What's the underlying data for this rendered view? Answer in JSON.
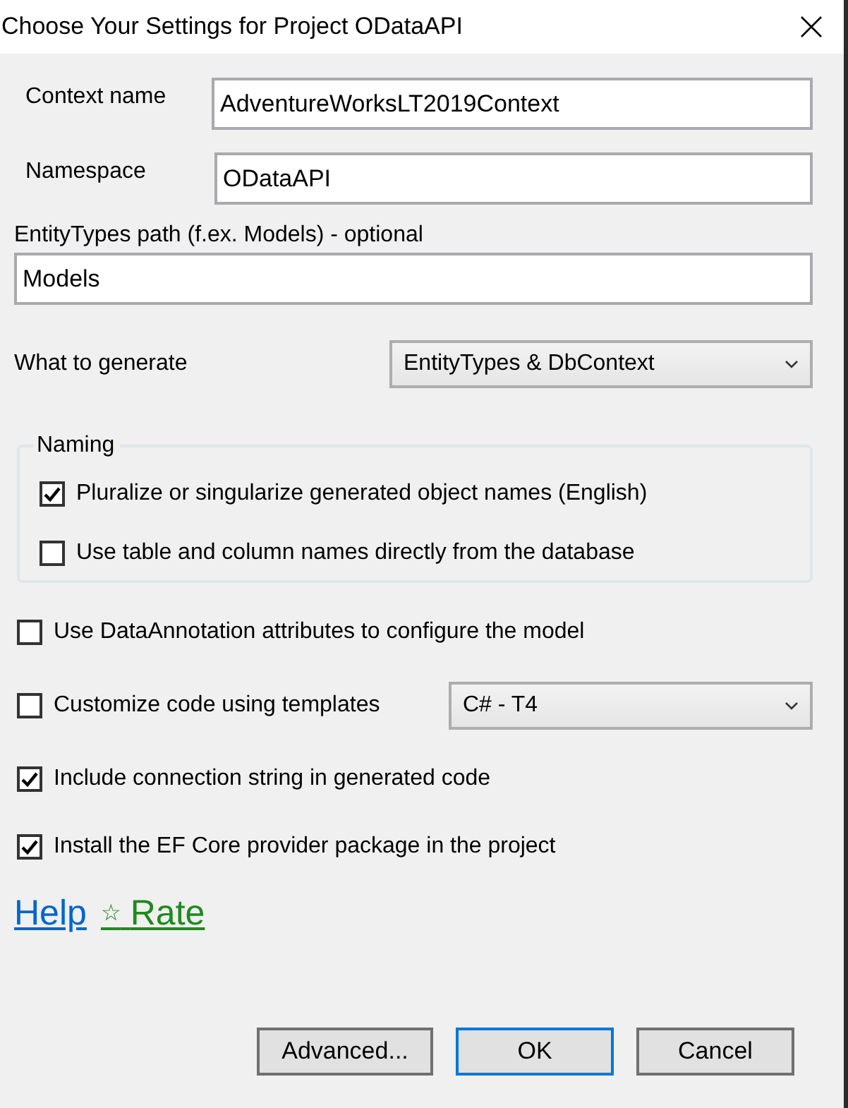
{
  "window": {
    "title": "Choose Your Settings for Project ODataAPI"
  },
  "fields": [
    {
      "label": "Context name",
      "value": "AdventureWorksLT2019Context"
    },
    {
      "label": "Namespace",
      "value": "ODataAPI"
    }
  ],
  "path_field": {
    "label": "EntityTypes path (f.ex. Models) - optional",
    "value": "Models"
  },
  "generate": {
    "label": "What to generate",
    "value": "EntityTypes & DbContext"
  },
  "naming": {
    "title": "Naming",
    "options": [
      {
        "label": "Pluralize or singularize generated object names (English)",
        "checked": true
      },
      {
        "label": "Use table and column names directly from the database",
        "checked": false
      }
    ]
  },
  "options": [
    {
      "kind": "checkbox",
      "label": "Use DataAnnotation attributes to configure the model",
      "checked": false
    },
    {
      "kind": "checkbox_select",
      "label": "Customize code using templates",
      "checked": false,
      "select": "C# - T4"
    },
    {
      "kind": "checkbox",
      "label": "Include connection string in generated code",
      "checked": true
    },
    {
      "kind": "checkbox",
      "label": "Install the EF Core provider package in the project",
      "checked": true
    }
  ],
  "links": [
    {
      "kind": "help",
      "label": "Help"
    },
    {
      "kind": "rate",
      "icon": "☆",
      "label": "Rate"
    }
  ],
  "buttons": [
    {
      "label": "Advanced...",
      "focused": false
    },
    {
      "label": "OK",
      "focused": true
    },
    {
      "label": "Cancel",
      "focused": false
    }
  ]
}
